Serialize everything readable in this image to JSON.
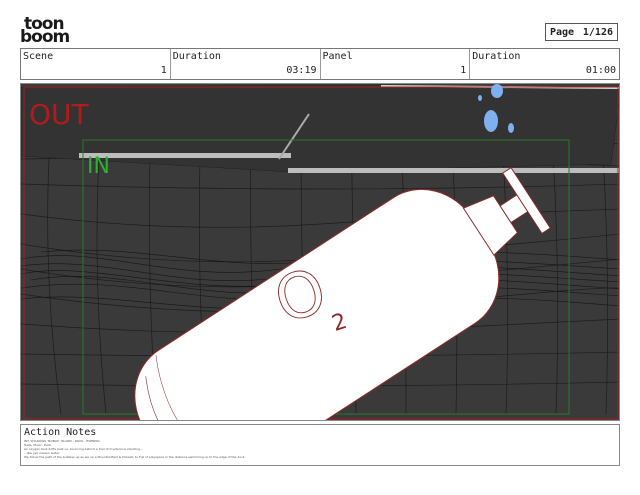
{
  "logo": {
    "line1": "toon",
    "line2": "boom"
  },
  "page": {
    "label": "Page",
    "value": "1/126"
  },
  "header": {
    "fields": [
      {
        "label": "Scene",
        "value": "1"
      },
      {
        "label": "Duration",
        "value": "03:19"
      },
      {
        "label": "Panel",
        "value": "1"
      },
      {
        "label": "Duration",
        "value": "01:00"
      }
    ]
  },
  "panel": {
    "out_label": "OUT",
    "in_label": "IN",
    "bottle_text": "O",
    "bottle_subscript": "2"
  },
  "colors": {
    "out_label": "#b31b1b",
    "in_label": "#2fae2f",
    "panel_bg": "#3a3a3a",
    "bubbles": "#7fb0f0"
  },
  "action_notes": {
    "title": "Action Notes",
    "lines": [
      "INT. SHADOWS 'NOBOS' ISLAND - ROCK - EVENING",
      "Haze, Music, Dark.",
      "An oxygen tank drifts past us, bouncing behind a trail of mysterious shooting...",
      "...like yet unseen water.",
      "We follow the path of the bubbles up as we up a Mountainfield & Dolwell. to Full of playspace in the distance swimming up to the edge of the dock."
    ]
  }
}
